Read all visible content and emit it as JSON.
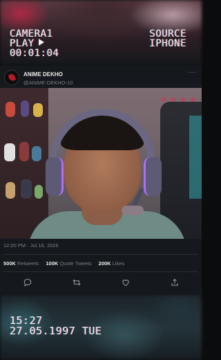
{
  "overlay_top": {
    "camera": "CAMERA1",
    "play": "PLAY",
    "timecode": "00:01:04",
    "source": "SOURCE",
    "device": "IPHONE"
  },
  "overlay_bottom": {
    "time": "15:27",
    "date": "27.05.1997 TUE"
  },
  "tweet": {
    "name": "ANIME DEKHO",
    "handle": "@ANIME-DEKHO-10",
    "more_icon": "ellipsis-icon",
    "timestamp": "12:00 PM · Jul 16, 2026",
    "retweets_count": "500K",
    "retweets_label": "Retweets",
    "quotes_count": "100K",
    "quotes_label": "Quote Tweets",
    "likes_count": "200K",
    "likes_label": "Likes",
    "actions": [
      "reply-icon",
      "retweet-icon",
      "like-icon",
      "share-icon"
    ]
  },
  "colors": {
    "card_bg": "#15181c",
    "text_primary": "#e9e9e9",
    "text_secondary": "#7a8089",
    "headset_accent": "#b26bff"
  }
}
